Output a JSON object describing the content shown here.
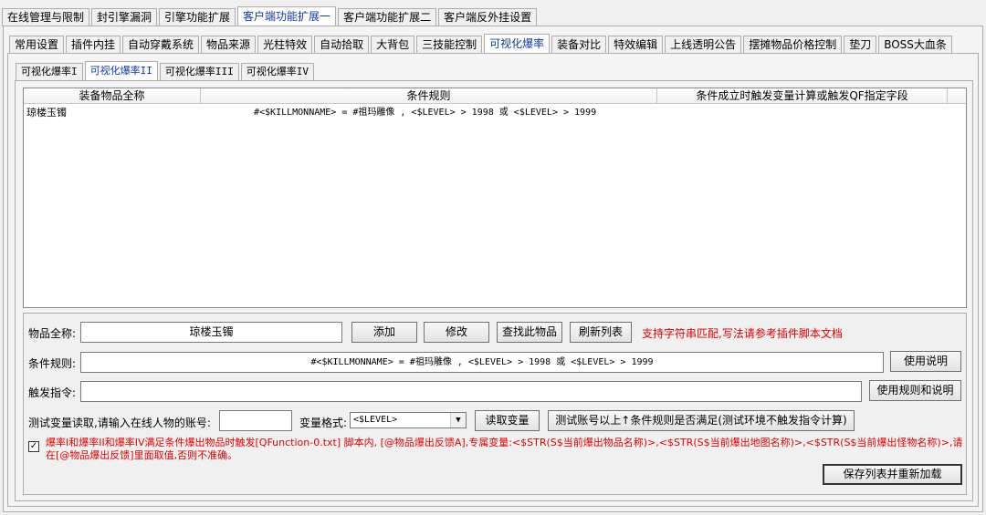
{
  "tabs_level1": [
    {
      "label": "在线管理与限制"
    },
    {
      "label": "封引擎漏洞"
    },
    {
      "label": "引擎功能扩展"
    },
    {
      "label": "客户端功能扩展一",
      "active": true
    },
    {
      "label": "客户端功能扩展二"
    },
    {
      "label": "客户端反外挂设置"
    }
  ],
  "tabs_level2": [
    {
      "label": "常用设置"
    },
    {
      "label": "插件内挂"
    },
    {
      "label": "自动穿戴系统"
    },
    {
      "label": "物品来源"
    },
    {
      "label": "光柱特效"
    },
    {
      "label": "自动拾取"
    },
    {
      "label": "大背包"
    },
    {
      "label": "三技能控制"
    },
    {
      "label": "可视化爆率",
      "active": true
    },
    {
      "label": "装备对比"
    },
    {
      "label": "特效编辑"
    },
    {
      "label": "上线透明公告"
    },
    {
      "label": "摆摊物品价格控制"
    },
    {
      "label": "垫刀"
    },
    {
      "label": "BOSS大血条"
    }
  ],
  "tabs_level3": [
    {
      "label": "可视化爆率I"
    },
    {
      "label": "可视化爆率II",
      "active": true
    },
    {
      "label": "可视化爆率III"
    },
    {
      "label": "可视化爆率IV"
    }
  ],
  "list": {
    "columns": [
      "装备物品全称",
      "条件规则",
      "条件成立时触发变量计算或触发QF指定字段"
    ],
    "rows": [
      {
        "item": "琼楼玉镯",
        "rule": "#<$KILLMONNAME> = #祖玛雕像 , <$LEVEL> > 1998 或 <$LEVEL> > 1999",
        "trigger": ""
      }
    ]
  },
  "form": {
    "item_label": "物品全称:",
    "item_value": "琼楼玉镯",
    "add_button": "添加",
    "modify_button": "修改",
    "find_button": "查找此物品",
    "refresh_button": "刷新列表",
    "hint": "支持字符串匹配,写法请参考插件脚本文档",
    "rule_label": "条件规则:",
    "rule_value": "#<$KILLMONNAME> = #祖玛雕像 , <$LEVEL> > 1998 或 <$LEVEL> > 1999",
    "usage_button": "使用说明",
    "trigger_label": "触发指令:",
    "trigger_value": "",
    "rules_usage_button": "使用规则和说明",
    "test_label": "测试变量读取,请输入在线人物的账号:",
    "test_account": "",
    "var_format_label": "变量格式:",
    "var_format_value": "<$LEVEL>",
    "read_var_button": "读取变量",
    "test_rule_button": "测试账号以上↑条件规则是否满足(测试环境不触发指令计算)",
    "checkbox_checked": true,
    "note": "爆率I和爆率II和爆率IV满足条件爆出物品时触发[QFunction-0.txt] 脚本内, [@物品爆出反馈A],专属变量:<$STR(S$当前爆出物品名称)>,<$STR(S$当前爆出地图名称)>,<$STR(S$当前爆出怪物名称)>,请在[@物品爆出反馈]里面取值,否则不准确。",
    "save_button": "保存列表并重新加载"
  }
}
